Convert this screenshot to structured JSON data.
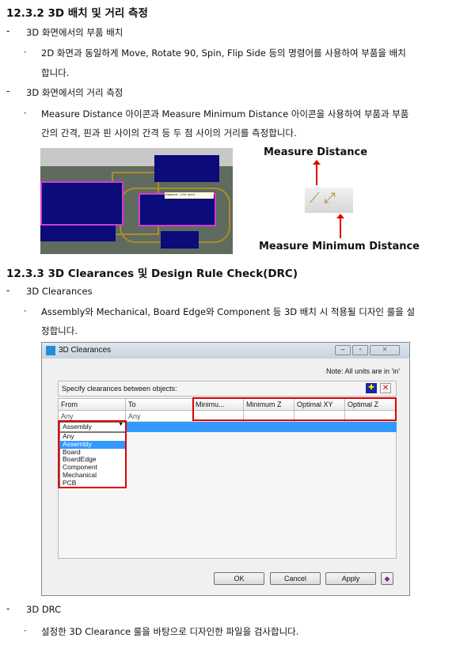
{
  "sections": [
    {
      "heading": "12.3.2 3D 배치 및 거리 측정",
      "items": [
        {
          "bullet": "-",
          "text": "3D 화면에서의 부품 배치",
          "sub": [
            "2D 화면과 동일하게 Move, Rotate 90, Spin, Flip Side 등의 명령어를 사용하여 부품을 배치",
            "합니다."
          ]
        },
        {
          "bullet": "-",
          "text": "3D 화면에서의 거리 측정",
          "sub": [
            "Measure Distance 아이콘과 Measure Minimum Distance 아이콘을 사용하여 부품과 부품",
            "간의 간격, 핀과 핀 사이의 간격 등 두 점 사이의 거리를 측정합니다."
          ]
        }
      ]
    },
    {
      "heading": "12.3.3 3D Clearances 및 Design Rule Check(DRC)",
      "items": [
        {
          "bullet": "-",
          "text": "3D Clearances",
          "sub": [
            "Assembly와 Mechanical, Board Edge와 Component 등 3D 배치 시 적용될 디자인 룰을 설",
            "정합니다."
          ]
        },
        {
          "bullet": "-",
          "text": "3D DRC",
          "sub": [
            "설정한 3D Clearance 룰을 바탕으로 디자인한 파일을 검사합니다."
          ]
        }
      ]
    }
  ],
  "figure1": {
    "tooltip": "Distance : 2.54 (mm)",
    "label_top": "Measure Distance",
    "label_bottom": "Measure Minimum Distance",
    "icons": [
      "ruler-icon",
      "ruler-arrows-icon"
    ]
  },
  "dialog": {
    "title": "3D Clearances",
    "note": "Note: All units are in 'in'",
    "specify": "Specify clearances between objects:",
    "columns": [
      "From",
      "To",
      "Minimu...",
      "Minimum Z",
      "Optimal XY",
      "Optimal Z"
    ],
    "row1": [
      "Any",
      "Any"
    ],
    "selected": "Assembly",
    "options": [
      "Any",
      "Assembly",
      "Board",
      "BoardEdge",
      "Component",
      "Mechanical",
      "PCB"
    ],
    "buttons": {
      "ok": "OK",
      "cancel": "Cancel",
      "apply": "Apply"
    },
    "colors": {
      "highlight": "#3399ff",
      "annotation": "#e00000"
    }
  }
}
